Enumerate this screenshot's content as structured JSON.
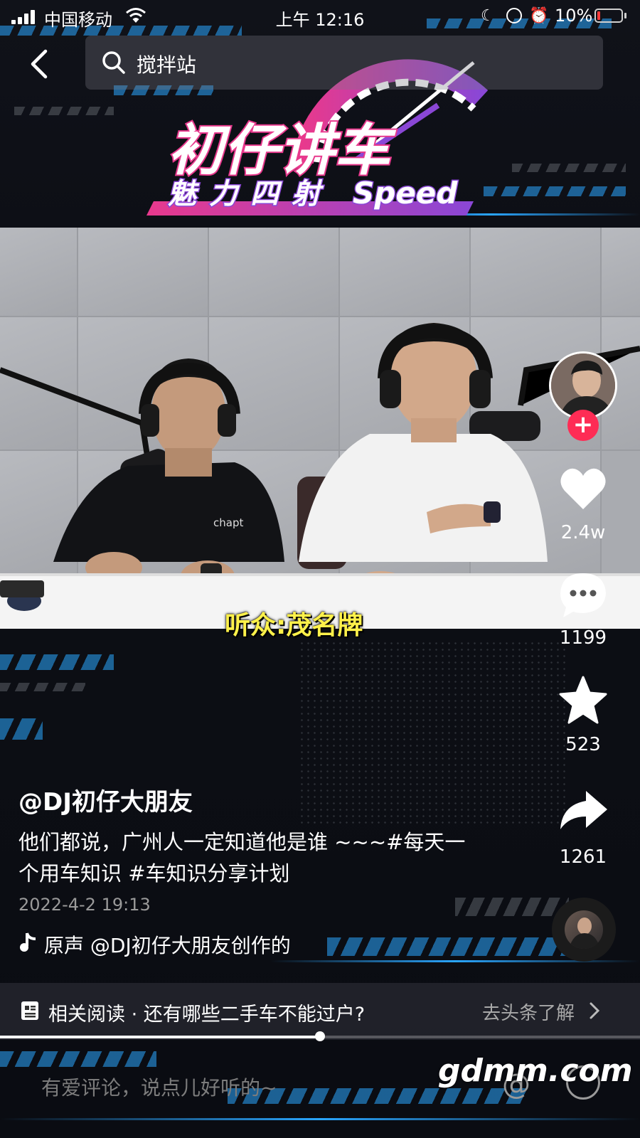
{
  "status_bar": {
    "carrier": "中国移动",
    "time": "上午 12:16",
    "battery": "10%"
  },
  "search": {
    "query": "搅拌站"
  },
  "logo": {
    "title": "初仔讲车",
    "subtitle": "魅力四射",
    "speed": "Speed"
  },
  "video": {
    "caption": "听众:茂名牌",
    "shirt_print": "chapt"
  },
  "rail": {
    "likes": "2.4w",
    "comments": "1199",
    "favorites": "523",
    "shares": "1261"
  },
  "post": {
    "username": "@DJ初仔大朋友",
    "description": "他们都说，广州人一定知道他是谁 ~~~#每天一个用车知识 #车知识分享计划",
    "date": "2022-4-2 19:13",
    "music": "原声    @DJ初仔大朋友创作的"
  },
  "related": {
    "text": "相关阅读 · 还有哪些二手车不能过户?",
    "link": "去头条了解"
  },
  "progress": {
    "fraction": 0.5
  },
  "comment": {
    "placeholder": "有爱评论，说点儿好听的~"
  },
  "watermark": "gdmm.com",
  "colors": {
    "accent_pink": "#fe2c55",
    "caption_yellow": "#fff14a",
    "stripe_blue": "#2aa6ff"
  }
}
